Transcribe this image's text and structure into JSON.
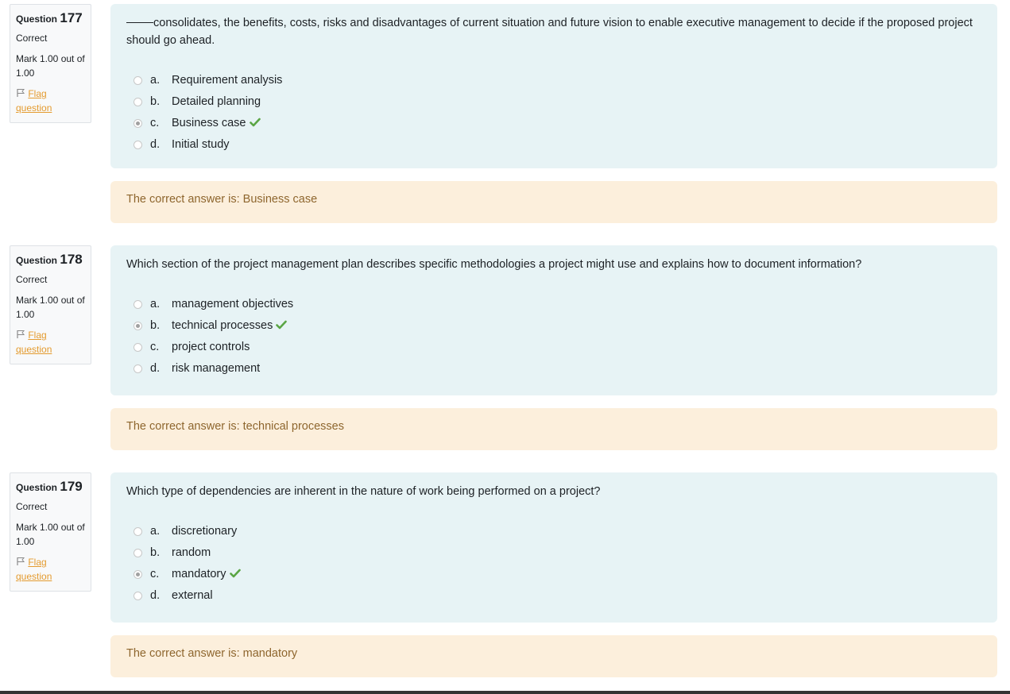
{
  "questions": [
    {
      "label": "Question",
      "number": "177",
      "state": "Correct",
      "grade": "Mark 1.00 out of 1.00",
      "flag_label": "Flag question",
      "text_after_blank": "consolidates, the benefits, costs, risks and disadvantages of current situation and future vision to enable executive management to decide if the proposed project should go ahead.",
      "options": [
        {
          "letter": "a.",
          "text": "Requirement analysis"
        },
        {
          "letter": "b.",
          "text": "Detailed planning"
        },
        {
          "letter": "c.",
          "text": "Business case"
        },
        {
          "letter": "d.",
          "text": "Initial study"
        }
      ],
      "selected_index": 2,
      "feedback": "The correct answer is: Business case"
    },
    {
      "label": "Question",
      "number": "178",
      "state": "Correct",
      "grade": "Mark 1.00 out of 1.00",
      "flag_label": "Flag question",
      "text": "Which section of the project management plan describes specific methodologies a project might use and explains how to document information?",
      "options": [
        {
          "letter": "a.",
          "text": "management objectives"
        },
        {
          "letter": "b.",
          "text": "technical processes"
        },
        {
          "letter": "c.",
          "text": "project controls"
        },
        {
          "letter": "d.",
          "text": "risk management"
        }
      ],
      "selected_index": 1,
      "feedback": "The correct answer is: technical processes"
    },
    {
      "label": "Question",
      "number": "179",
      "state": "Correct",
      "grade": "Mark 1.00 out of 1.00",
      "flag_label": "Flag question",
      "text": "Which type of dependencies are inherent in the nature of work being performed on a project?",
      "options": [
        {
          "letter": "a.",
          "text": "discretionary"
        },
        {
          "letter": "b.",
          "text": "random"
        },
        {
          "letter": "c.",
          "text": "mandatory"
        },
        {
          "letter": "d.",
          "text": "external"
        }
      ],
      "selected_index": 2,
      "feedback": "The correct answer is: mandatory"
    }
  ],
  "colors": {
    "formulation_bg": "#e7f3f5",
    "feedback_bg": "#fcefdc",
    "feedback_text": "#8e662e",
    "correct_check": "#5aa544",
    "flag_link": "#e49b2f"
  }
}
